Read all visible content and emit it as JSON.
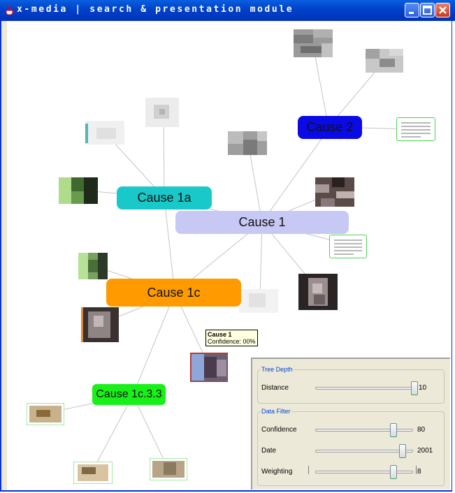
{
  "window": {
    "title": "x-media | search & presentation module",
    "colors": {
      "titlebar": "#0044cc",
      "close": "#c83a1c"
    }
  },
  "graph": {
    "nodes": [
      {
        "id": "cause2",
        "label": "Cause 2",
        "color": "#0a0ae6"
      },
      {
        "id": "cause1a",
        "label": "Cause 1a",
        "color": "#19c8c8"
      },
      {
        "id": "cause1",
        "label": "Cause 1",
        "color": "#c8c8f5"
      },
      {
        "id": "cause1c",
        "label": "Cause 1c",
        "color": "#ff9a00"
      },
      {
        "id": "cause1c33",
        "label": "Cause 1c.3.3",
        "color": "#19f019"
      }
    ],
    "tooltip": {
      "title": "Cause 1",
      "detail": "Confidence: 00%"
    }
  },
  "controls": {
    "tree_depth": {
      "legend": "Tree Depth",
      "distance": {
        "label": "Distance",
        "value": "10",
        "fraction": 1.0
      }
    },
    "data_filter": {
      "legend": "Data Filter",
      "confidence": {
        "label": "Confidence",
        "value": "80",
        "fraction": 0.82
      },
      "date": {
        "label": "Date",
        "value": "2001",
        "fraction": 0.92
      },
      "weighting": {
        "label": "Weighting",
        "value": "8",
        "fraction": 0.8
      }
    }
  }
}
